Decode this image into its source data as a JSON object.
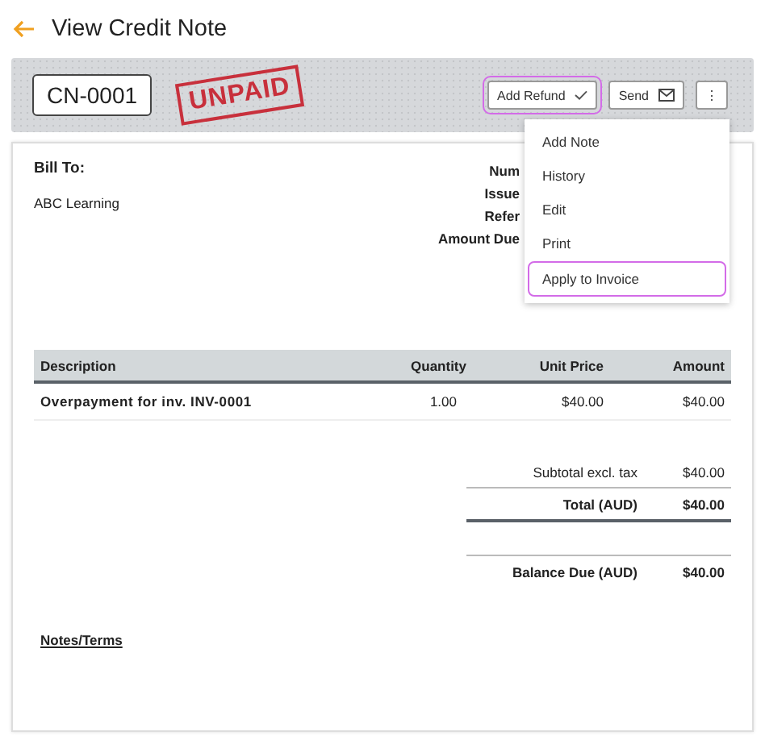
{
  "page": {
    "title": "View Credit Note"
  },
  "toolbar": {
    "number": "CN-0001",
    "stamp": "UNPAID",
    "buttons": [
      {
        "label": "Add Refund",
        "kind": "check",
        "highlighted": true
      },
      {
        "label": "Send",
        "kind": "mail",
        "highlighted": false
      },
      {
        "label": "⋮",
        "kind": "more",
        "highlighted": false
      }
    ]
  },
  "menu": {
    "items": [
      {
        "label": "Add Note",
        "highlighted": false
      },
      {
        "label": "History",
        "highlighted": false
      },
      {
        "label": "Edit",
        "highlighted": false
      },
      {
        "label": "Print",
        "highlighted": false
      },
      {
        "label": "Apply to Invoice",
        "highlighted": true
      }
    ]
  },
  "bill_to": {
    "heading": "Bill To:",
    "name": "ABC Learning"
  },
  "details": [
    "Num",
    "Issue",
    "Refer",
    "Amount Due"
  ],
  "table": {
    "columns": [
      "Description",
      "Quantity",
      "Unit Price",
      "Amount"
    ],
    "rows": [
      [
        "Overpayment for inv. INV-0001",
        "1.00",
        "$40.00",
        "$40.00"
      ]
    ]
  },
  "totals": [
    {
      "label": "Subtotal excl. tax",
      "value": "$40.00",
      "kind": "subtotal"
    },
    {
      "label": "Total (AUD)",
      "value": "$40.00",
      "kind": "total"
    },
    {
      "label": "Balance Due (AUD)",
      "value": "$40.00",
      "kind": "balance"
    }
  ],
  "notes_heading": "Notes/Terms"
}
